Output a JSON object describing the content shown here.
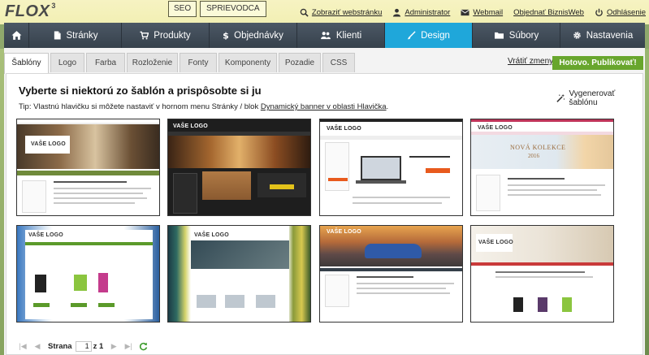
{
  "app": {
    "logo": "FLOX",
    "logo_version": "3"
  },
  "topbar": {
    "seo_label": "SEO",
    "guide_label": "SPRIEVODCA",
    "links": [
      {
        "label": "Zobraziť webstránku",
        "icon": "search-icon"
      },
      {
        "label": "Administrator",
        "icon": "user-icon"
      },
      {
        "label": "Webmail",
        "icon": "mail-icon"
      },
      {
        "label": "Objednať BiznisWeb",
        "icon": "none"
      },
      {
        "label": "Odhlásenie",
        "icon": "power-icon"
      }
    ]
  },
  "nav": {
    "items": [
      {
        "label": "",
        "icon": "home-icon"
      },
      {
        "label": "Stránky",
        "icon": "page-icon"
      },
      {
        "label": "Produkty",
        "icon": "cart-icon"
      },
      {
        "label": "Objednávky",
        "icon": "dollar-icon"
      },
      {
        "label": "Klienti",
        "icon": "users-icon"
      },
      {
        "label": "Design",
        "icon": "brush-icon",
        "active": true
      },
      {
        "label": "Súbory",
        "icon": "folder-icon"
      },
      {
        "label": "Nastavenia",
        "icon": "gear-icon"
      }
    ]
  },
  "tabs": [
    "Šablóny",
    "Logo",
    "Farba",
    "Rozloženie",
    "Fonty",
    "Komponenty",
    "Pozadie",
    "CSS"
  ],
  "actions": {
    "undo_label": "Vrátiť zmeny",
    "publish_label": "Hotovo. Publikovať!"
  },
  "main": {
    "heading": "Vyberte si niektorú zo šablón a prispôsobte si ju",
    "tip_prefix": "Tip: Vlastnú hlavičku si môžete nastaviť v hornom menu Stránky / blok ",
    "tip_link": "Dynamický banner v oblasti Hlavička",
    "tip_suffix": ".",
    "generate_label": "Vygenerovať šablónu"
  },
  "templates": [
    {
      "logo": "VAŠE LOGO",
      "theme": "interior"
    },
    {
      "logo": "VAŠE LOGO",
      "theme": "dark"
    },
    {
      "logo": "VAŠE LOGO",
      "theme": "shop-laptop"
    },
    {
      "logo": "VAŠE LOGO",
      "theme": "nova-kolekce",
      "banner": "NOVÁ KOLEKCE",
      "banner_year": "2016"
    },
    {
      "logo": "VAŠE LOGO",
      "theme": "sky"
    },
    {
      "logo": "VAŠE LOGO",
      "theme": "stripes"
    },
    {
      "logo": "VAŠE LOGO",
      "theme": "car"
    },
    {
      "logo": "VAŠE LOGO",
      "theme": "desk"
    }
  ],
  "pager": {
    "page_label": "Strana",
    "page_value": "1",
    "of_label": "z 1"
  },
  "colors": {
    "nav_bg": "#3b4652",
    "nav_active": "#1fa7da",
    "publish": "#68a62d",
    "topbar": "#f4f1b9"
  }
}
